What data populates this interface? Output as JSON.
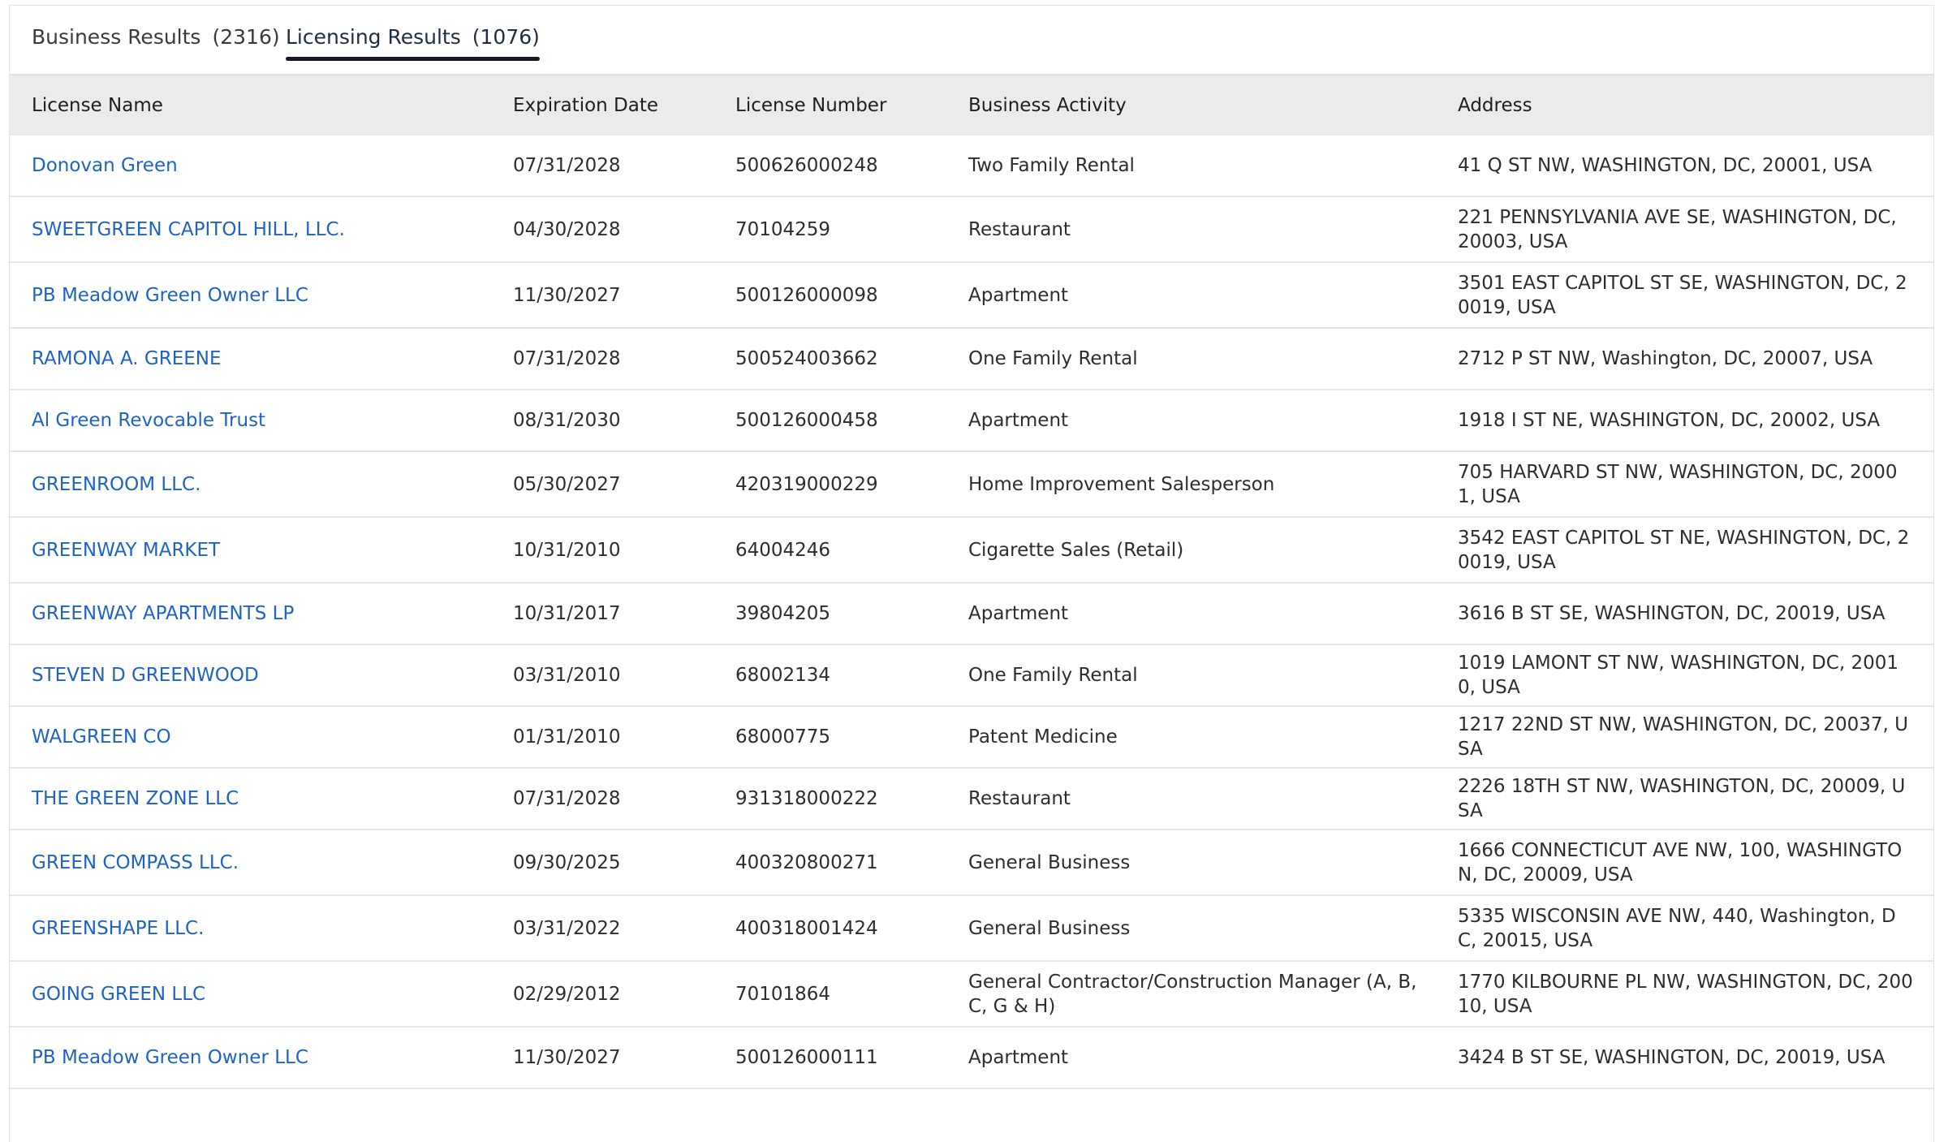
{
  "tabs": [
    {
      "label": "Business Results",
      "count": "(2316)",
      "active": false
    },
    {
      "label": "Licensing Results",
      "count": "(1076)",
      "active": true
    }
  ],
  "table": {
    "headers": [
      "License Name",
      "Expiration Date",
      "License Number",
      "Business Activity",
      "Address"
    ],
    "rows": [
      {
        "name": "Donovan Green",
        "expiration": "07/31/2028",
        "number": "500626000248",
        "activity": "Two Family Rental",
        "address": "41 Q ST NW, WASHINGTON, DC, 20001, USA"
      },
      {
        "name": "SWEETGREEN CAPITOL HILL, LLC.",
        "expiration": "04/30/2028",
        "number": "70104259",
        "activity": "Restaurant",
        "address": "221 PENNSYLVANIA AVE SE, WASHINGTON, DC, 20003, USA"
      },
      {
        "name": "PB Meadow Green Owner LLC",
        "expiration": "11/30/2027",
        "number": "500126000098",
        "activity": "Apartment",
        "address": "3501 EAST CAPITOL ST SE, WASHINGTON, DC, 20019, USA"
      },
      {
        "name": "RAMONA A. GREENE",
        "expiration": "07/31/2028",
        "number": "500524003662",
        "activity": "One Family Rental",
        "address": "2712 P ST NW, Washington, DC, 20007, USA"
      },
      {
        "name": "Al Green Revocable Trust",
        "expiration": "08/31/2030",
        "number": "500126000458",
        "activity": "Apartment",
        "address": "1918 I ST NE, WASHINGTON, DC, 20002, USA"
      },
      {
        "name": "GREENROOM LLC.",
        "expiration": "05/30/2027",
        "number": "420319000229",
        "activity": "Home Improvement Salesperson",
        "address": "705 HARVARD ST NW, WASHINGTON, DC, 20001, USA"
      },
      {
        "name": "GREENWAY MARKET",
        "expiration": "10/31/2010",
        "number": "64004246",
        "activity": "Cigarette Sales (Retail)",
        "address": "3542 EAST CAPITOL ST NE, WASHINGTON, DC, 20019, USA"
      },
      {
        "name": "GREENWAY APARTMENTS LP",
        "expiration": "10/31/2017",
        "number": "39804205",
        "activity": "Apartment",
        "address": "3616 B ST SE, WASHINGTON, DC, 20019, USA"
      },
      {
        "name": "STEVEN D GREENWOOD",
        "expiration": "03/31/2010",
        "number": "68002134",
        "activity": "One Family Rental",
        "address": "1019 LAMONT ST NW, WASHINGTON, DC, 20010, USA"
      },
      {
        "name": "WALGREEN CO",
        "expiration": "01/31/2010",
        "number": "68000775",
        "activity": "Patent Medicine",
        "address": "1217 22ND ST NW, WASHINGTON, DC, 20037, USA"
      },
      {
        "name": "THE GREEN ZONE LLC",
        "expiration": "07/31/2028",
        "number": "931318000222",
        "activity": "Restaurant",
        "address": "2226 18TH ST NW, WASHINGTON, DC, 20009, USA"
      },
      {
        "name": "GREEN COMPASS LLC.",
        "expiration": "09/30/2025",
        "number": "400320800271",
        "activity": "General Business",
        "address": "1666 CONNECTICUT AVE NW, 100, WASHINGTON, DC, 20009, USA"
      },
      {
        "name": "GREENSHAPE LLC.",
        "expiration": "03/31/2022",
        "number": "400318001424",
        "activity": "General Business",
        "address": "5335 WISCONSIN AVE NW, 440, Washington, DC, 20015, USA"
      },
      {
        "name": "GOING GREEN LLC",
        "expiration": "02/29/2012",
        "number": "70101864",
        "activity": "General Contractor/Construction Manager (A, B, C, G & H)",
        "address": "1770 KILBOURNE PL NW, WASHINGTON, DC, 20010, USA"
      },
      {
        "name": "PB Meadow Green Owner LLC",
        "expiration": "11/30/2027",
        "number": "500126000111",
        "activity": "Apartment",
        "address": "3424 B ST SE, WASHINGTON, DC, 20019, USA"
      }
    ]
  }
}
